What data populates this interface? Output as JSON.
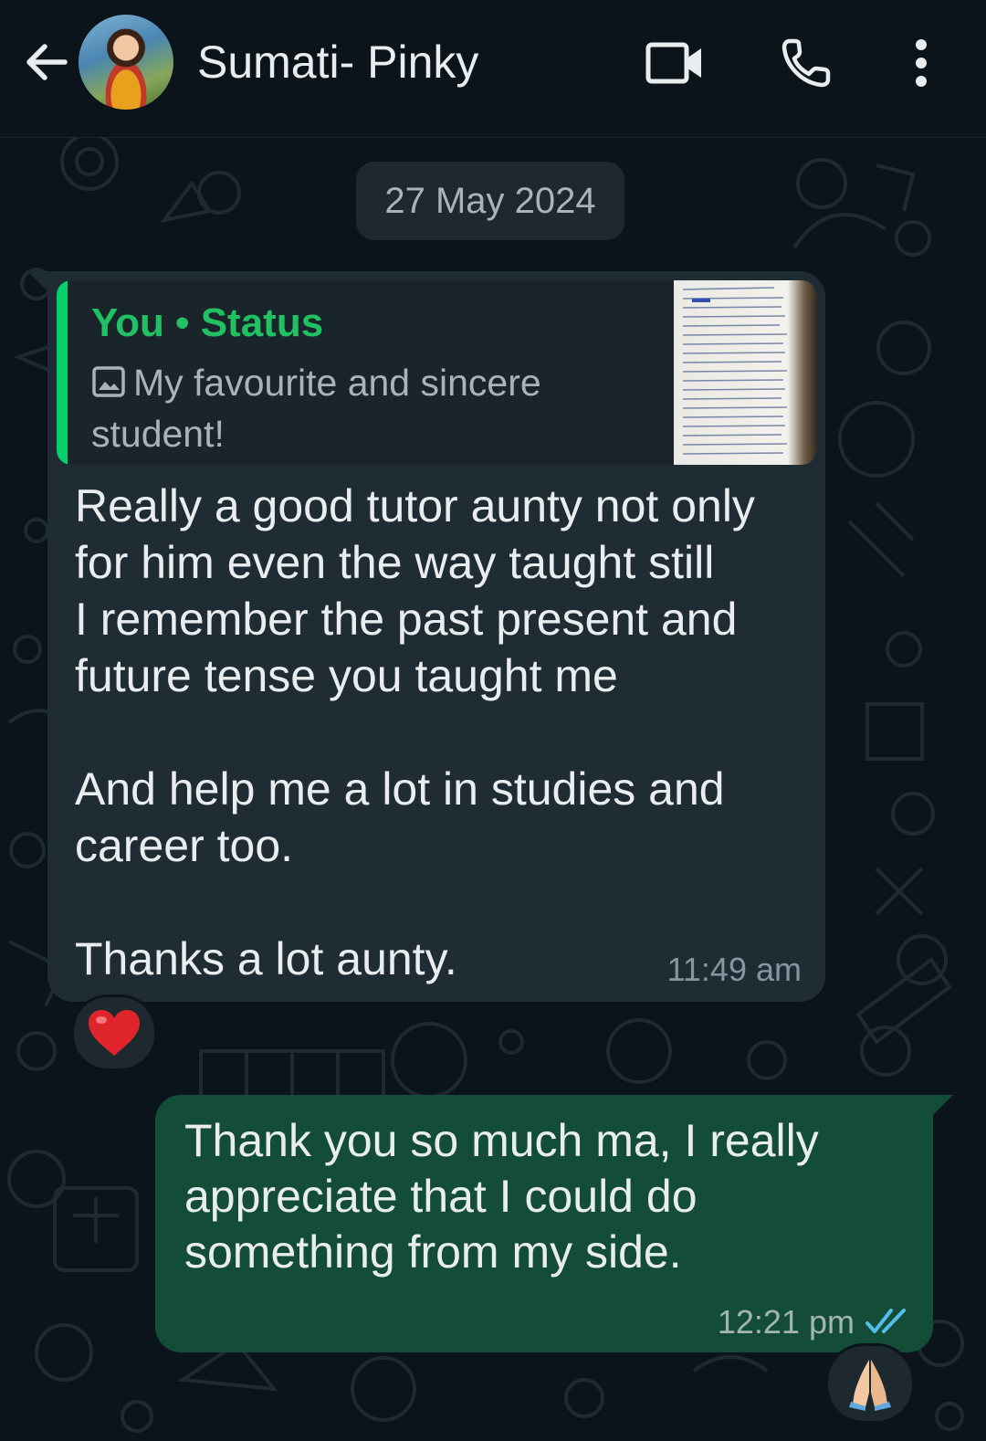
{
  "header": {
    "contact_name": "Sumati- Pinky",
    "back_icon": "arrow-left-icon",
    "video_icon": "video-call-icon",
    "call_icon": "phone-icon",
    "menu_icon": "more-vertical-icon"
  },
  "chat": {
    "date_separator": "27 May 2024",
    "messages": [
      {
        "direction": "incoming",
        "quote": {
          "author": "You • Status",
          "media_icon": "image-icon",
          "text": "My favourite and sincere student!"
        },
        "text": "Really a good tutor aunty not only for him even the way taught still\nI remember the past present and future tense you taught me\n\nAnd help me a lot in studies and career too.\n\nThanks a lot aunty.",
        "time": "11:49 am",
        "reaction": "❤️"
      },
      {
        "direction": "outgoing",
        "text": "Thank you so much ma, I really appreciate that I could do something from my side.",
        "time": "12:21 pm",
        "status_icon": "double-check-read-icon",
        "reaction": "🙏🏻"
      }
    ]
  },
  "colors": {
    "background": "#0b141a",
    "incoming_bubble": "#202c33",
    "outgoing_bubble": "#144d37",
    "accent_green": "#21c063",
    "read_tick_blue": "#53bdeb"
  }
}
